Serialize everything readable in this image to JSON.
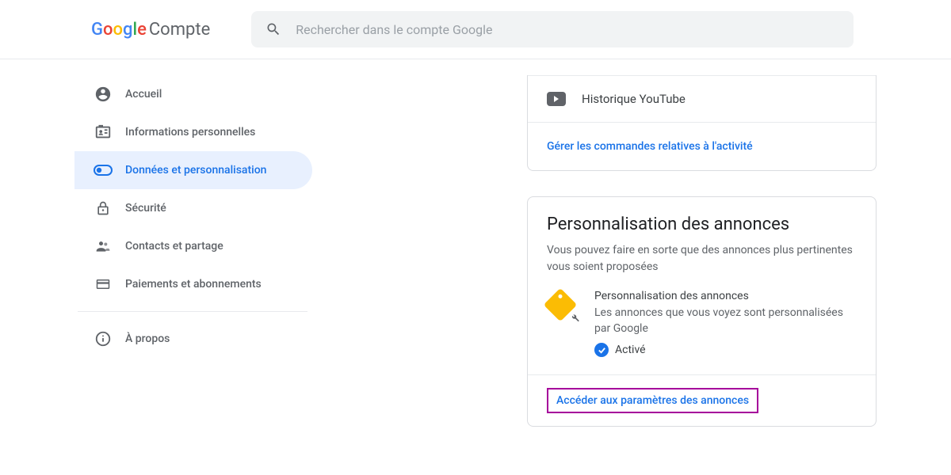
{
  "header": {
    "logo_suffix": "Compte",
    "search_placeholder": "Rechercher dans le compte Google"
  },
  "sidebar": {
    "items": [
      {
        "label": "Accueil"
      },
      {
        "label": "Informations personnelles"
      },
      {
        "label": "Données et personnalisation"
      },
      {
        "label": "Sécurité"
      },
      {
        "label": "Contacts et partage"
      },
      {
        "label": "Paiements et abonnements"
      }
    ],
    "about_label": "À propos"
  },
  "history_card": {
    "youtube_label": "Historique YouTube",
    "manage_link": "Gérer les commandes relatives à l'activité"
  },
  "ads_card": {
    "title": "Personnalisation des annonces",
    "subtitle": "Vous pouvez faire en sorte que des annonces plus pertinentes vous soient proposées",
    "row_title": "Personnalisation des annonces",
    "row_desc": "Les annonces que vous voyez sont personnalisées par Google",
    "status_label": "Activé",
    "footer_link": "Accéder aux paramètres des annonces"
  }
}
